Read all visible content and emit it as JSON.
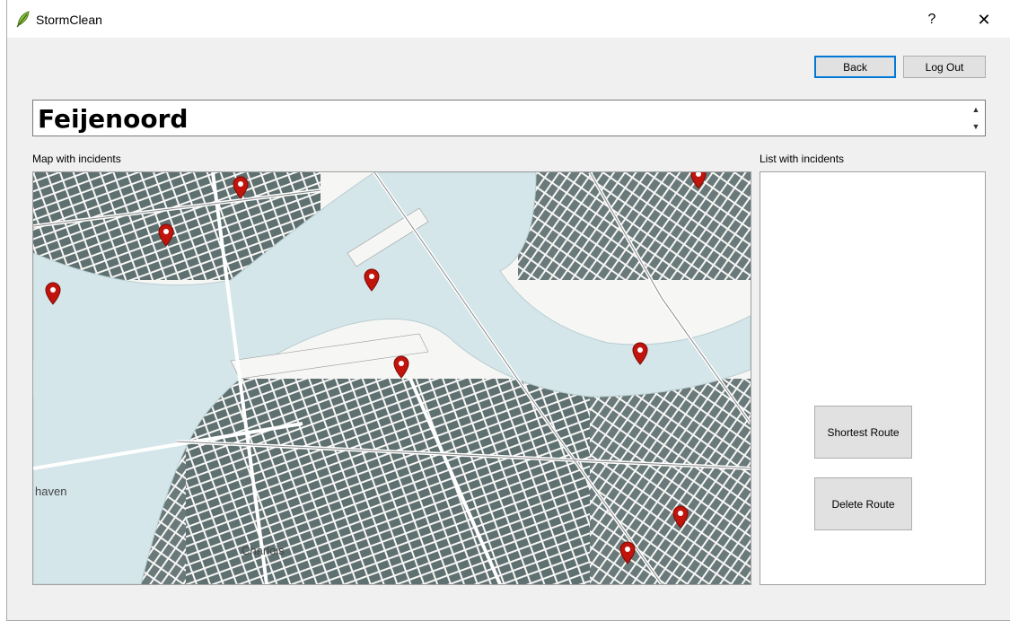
{
  "window": {
    "title": "StormClean",
    "help_label": "?",
    "close_label": "✕"
  },
  "header": {
    "back_label": "Back",
    "logout_label": "Log Out"
  },
  "district": {
    "name": "Feijenoord"
  },
  "map": {
    "label": "Map with incidents",
    "place_labels": [
      "haven",
      "Charlois"
    ]
  },
  "incidents": {
    "label": "List with incidents",
    "items": []
  },
  "actions": {
    "shortest_route_label": "Shortest Route",
    "delete_route_label": "Delete Route"
  },
  "colors": {
    "water": "#d4e6ea",
    "buildings": "#5f7070",
    "roads": "#ffffff",
    "marker": "#c0140c",
    "accent": "#0078d7"
  }
}
